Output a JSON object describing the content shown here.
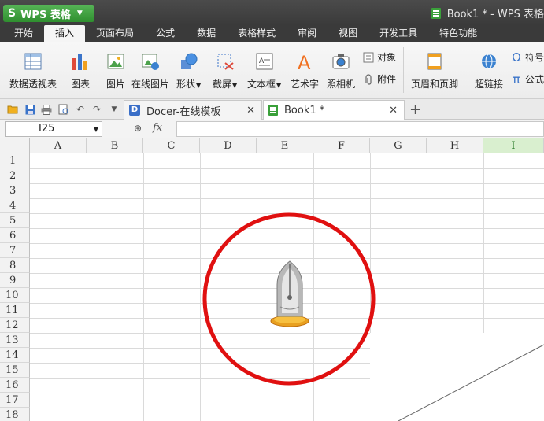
{
  "app": {
    "name": "WPS 表格",
    "logo": "S",
    "accent": "#3a9a3a"
  },
  "window_title": "Book1 * - WPS 表格",
  "menu_tabs": [
    "开始",
    "插入",
    "页面布局",
    "公式",
    "数据",
    "表格样式",
    "审阅",
    "视图",
    "开发工具",
    "特色功能"
  ],
  "active_menu_tab": "插入",
  "ribbon": {
    "pivot_table": "数据透视表",
    "chart": "图表",
    "picture": "图片",
    "online_picture": "在线图片",
    "shapes": "形状",
    "screenshot": "截屏",
    "textbox": "文本框",
    "wordart": "艺术字",
    "camera": "照相机",
    "object": "对象",
    "attachment": "附件",
    "header_footer": "页眉和页脚",
    "hyperlink": "超链接",
    "symbol": "符号",
    "formula": "公式"
  },
  "doc_tabs": [
    {
      "label": "Docer-在线模板",
      "active": false
    },
    {
      "label": "Book1 *",
      "active": true
    }
  ],
  "formula_bar": {
    "cell_ref": "I25",
    "fx": "fx",
    "value": ""
  },
  "columns": [
    "A",
    "B",
    "C",
    "D",
    "E",
    "F",
    "G",
    "H",
    "I"
  ],
  "selected_column": "I",
  "rows": [
    "1",
    "2",
    "3",
    "4",
    "5",
    "6",
    "7",
    "8",
    "9",
    "10",
    "11",
    "12",
    "13",
    "14",
    "15",
    "16",
    "17",
    "18"
  ],
  "annotation": {
    "circle_color": "#e01010",
    "icon": "pen-nib-icon"
  }
}
